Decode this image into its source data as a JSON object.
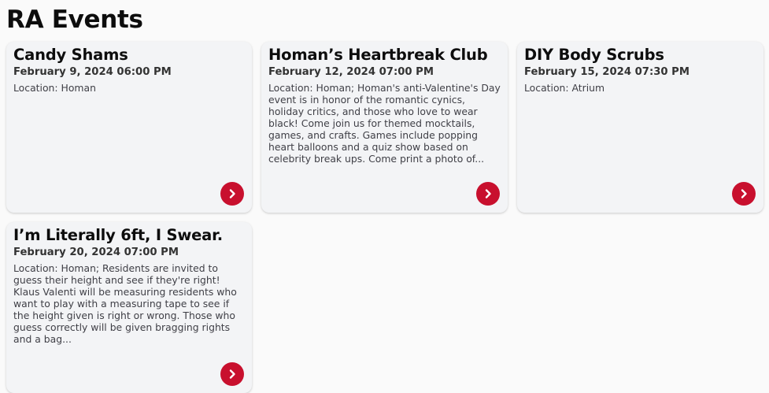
{
  "page": {
    "title": "RA Events"
  },
  "theme": {
    "accent": "#c8102e",
    "card_bg": "#f3f4f6",
    "page_bg": "#fafafa"
  },
  "events": [
    {
      "title": "Candy Shams",
      "date": "February 9, 2024 06:00 PM",
      "description": "Location: Homan",
      "icon": "chevron-right-icon"
    },
    {
      "title": "Homan’s Heartbreak Club",
      "date": "February 12, 2024 07:00 PM",
      "description": "Location: Homan; Homan's anti-Valentine's Day event is in honor of the romantic cynics, holiday critics, and those who love to wear black! Come join us for themed mocktails, games, and crafts. Games include popping heart balloons and a quiz show based on celebrity break ups. Come print a photo of...",
      "icon": "chevron-right-icon"
    },
    {
      "title": "DIY Body Scrubs",
      "date": "February 15, 2024 07:30 PM",
      "description": "Location: Atrium",
      "icon": "chevron-right-icon"
    },
    {
      "title": "I’m Literally 6ft, I Swear.",
      "date": "February 20, 2024 07:00 PM",
      "description": "Location: Homan; Residents are invited to guess their height and see if they're right! Klaus Valenti will be measuring residents who want to play with a measuring tape to see if the height given is right or wrong. Those who guess correctly will be given bragging rights and a bag...",
      "icon": "chevron-right-icon"
    }
  ]
}
